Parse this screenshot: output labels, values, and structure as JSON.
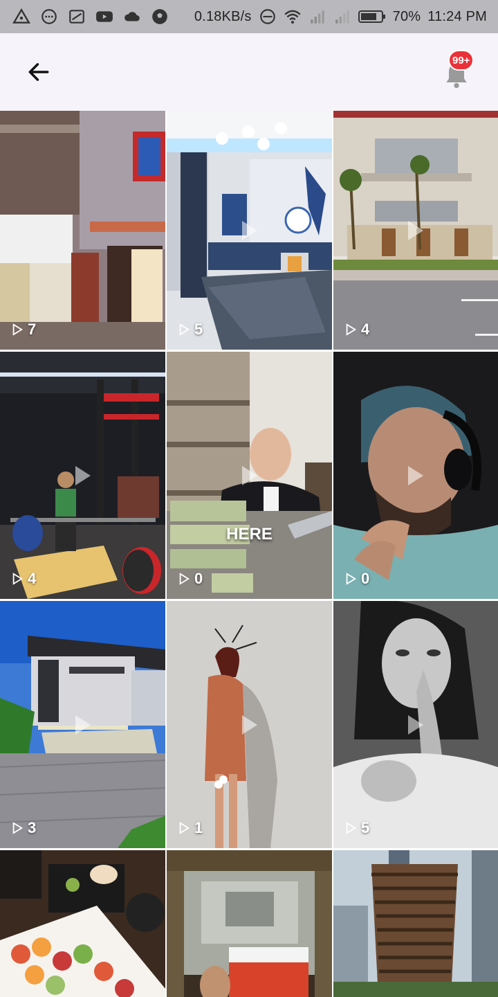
{
  "status_bar": {
    "net_speed": "0.18KB/s",
    "battery": "70%",
    "time": "11:24 PM",
    "icons": [
      "app-triangle-icon",
      "chat-bubble-icon",
      "screenshot-icon",
      "youtube-icon",
      "cloud-icon",
      "soccer-ball-icon",
      "do-not-disturb-icon",
      "wifi-icon",
      "signal-icon",
      "signal-icon",
      "battery-icon"
    ]
  },
  "app_bar": {
    "back_icon": "arrow-left-icon",
    "bell_icon": "bell-icon",
    "badge": "99+"
  },
  "colors": {
    "status_bar_bg": "#b9b9bd",
    "app_bar_bg": "#f6f4fa",
    "badge": "#e8323a"
  },
  "grid": {
    "columns": 3,
    "tiles": [
      {
        "scene": "storefront building",
        "count": "7",
        "overlay": ""
      },
      {
        "scene": "football-themed bedroom",
        "count": "5",
        "overlay": ""
      },
      {
        "scene": "mansion exterior",
        "count": "4",
        "overlay": ""
      },
      {
        "scene": "gym deadlift",
        "count": "4",
        "overlay": ""
      },
      {
        "scene": "man with stacks of cash",
        "count": "0",
        "overlay": "HERE"
      },
      {
        "scene": "man with headphones",
        "count": "0",
        "overlay": ""
      },
      {
        "scene": "modern house",
        "count": "3",
        "overlay": ""
      },
      {
        "scene": "woman in coat art",
        "count": "1",
        "overlay": ""
      },
      {
        "scene": "black and white woman",
        "count": "5",
        "overlay": ""
      },
      {
        "scene": "sushi platter",
        "count": "",
        "overlay": ""
      },
      {
        "scene": "Playbill theater",
        "count": "",
        "overlay": ""
      },
      {
        "scene": "Vessel structure",
        "count": "",
        "overlay": ""
      }
    ]
  }
}
